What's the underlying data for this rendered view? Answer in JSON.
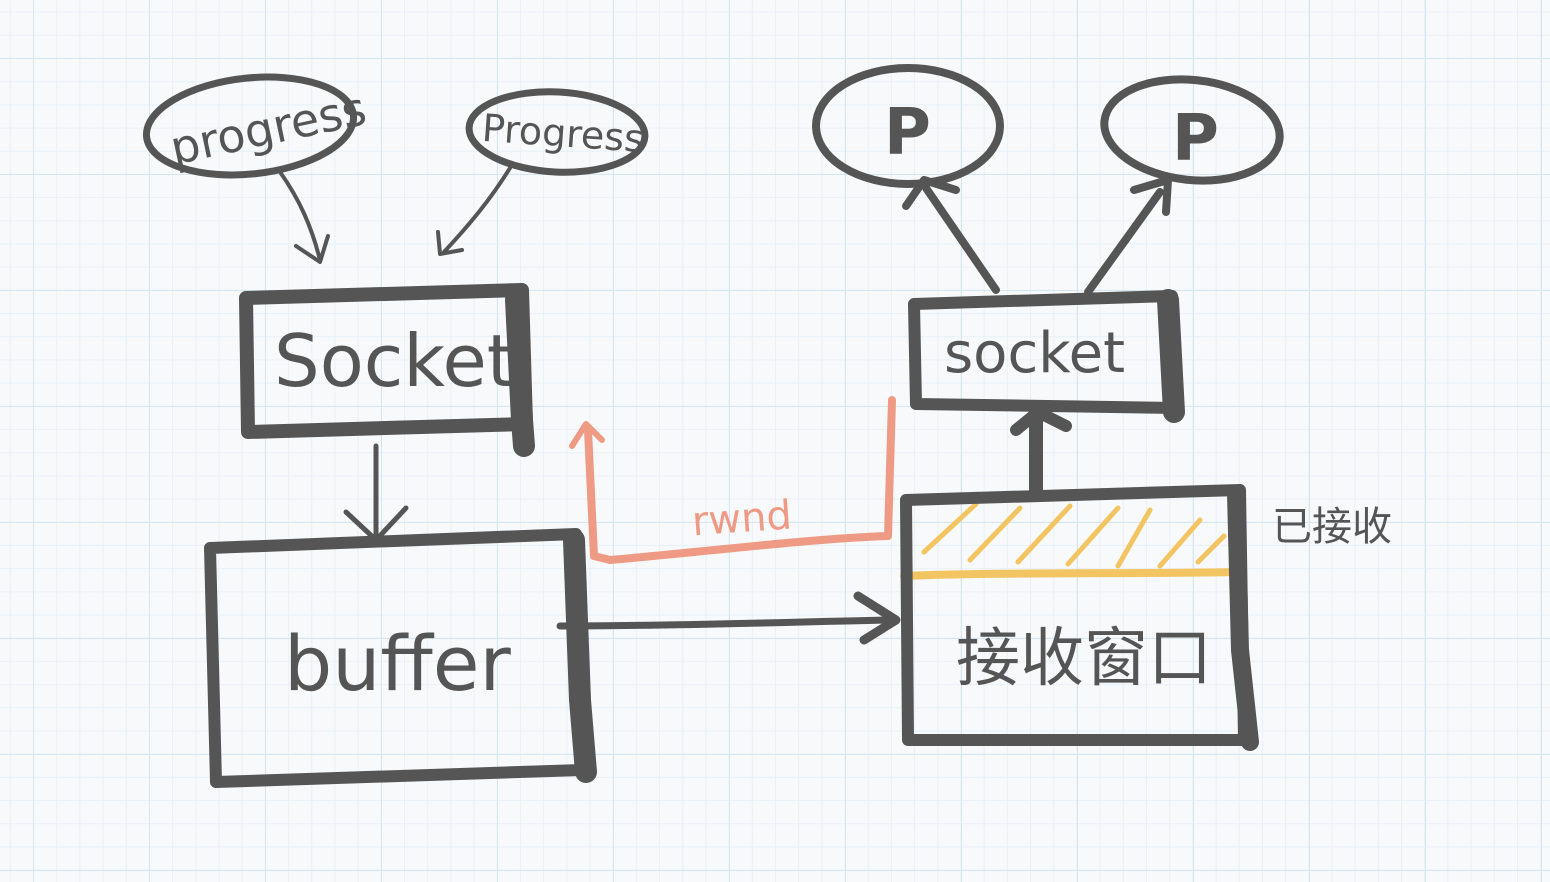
{
  "diagram": {
    "sender": {
      "process_left": "progress",
      "process_right": "Progress",
      "socket": "Socket",
      "buffer": "buffer"
    },
    "receiver": {
      "process_left": "P",
      "process_right": "P",
      "socket": "socket",
      "window": "接收窗口",
      "received_note": "已接收"
    },
    "feedback": {
      "label": "rwnd"
    },
    "colors": {
      "ink": "#555555",
      "rwnd": "#ef9a84",
      "received": "#f2c462"
    }
  }
}
